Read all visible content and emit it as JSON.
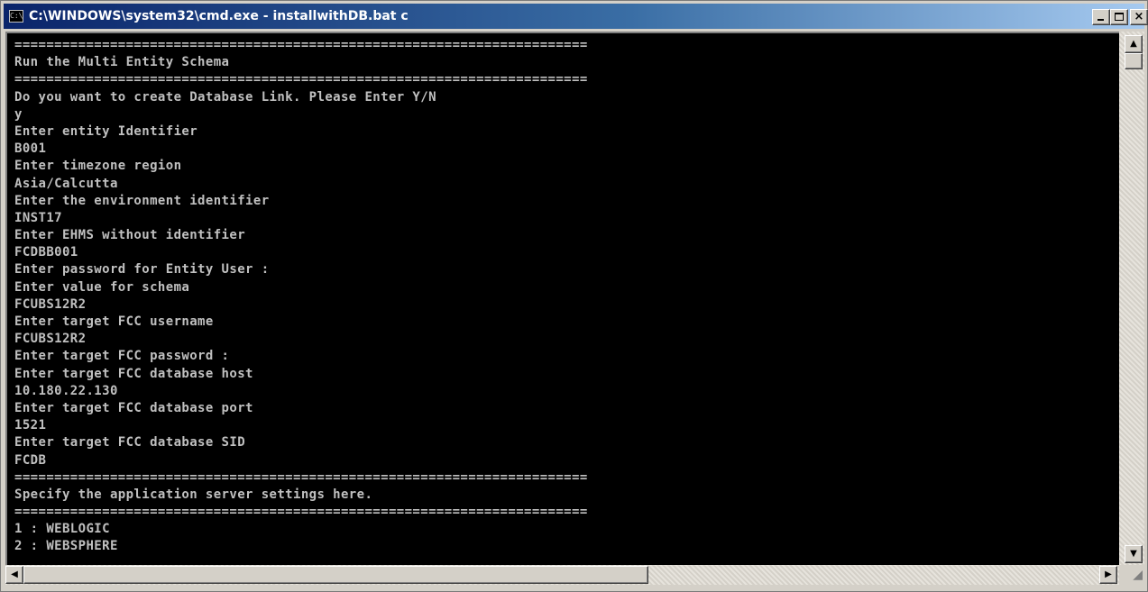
{
  "window": {
    "title": "C:\\WINDOWS\\system32\\cmd.exe - installwithDB.bat c",
    "icon_name": "cmd-console-icon",
    "icon_text": "C:\\",
    "minimize_label": "_",
    "maximize_label": "□",
    "close_label": "×"
  },
  "colors": {
    "title_bar_start": "#0a246a",
    "title_bar_end": "#a6caf0",
    "console_background": "#000000",
    "console_text": "#c0c0c0",
    "chrome": "#d4d0c8"
  },
  "console": {
    "lines": [
      "========================================================================",
      "Run the Multi Entity Schema",
      "========================================================================",
      "Do you want to create Database Link. Please Enter Y/N",
      "y",
      "Enter entity Identifier",
      "B001",
      "Enter timezone region",
      "Asia/Calcutta",
      "Enter the environment identifier",
      "INST17",
      "Enter EHMS without identifier",
      "FCDBB001",
      "Enter password for Entity User :",
      "Enter value for schema",
      "FCUBS12R2",
      "Enter target FCC username",
      "FCUBS12R2",
      "Enter target FCC password :",
      "Enter target FCC database host",
      "10.180.22.130",
      "Enter target FCC database port",
      "1521",
      "Enter target FCC database SID",
      "FCDB",
      "========================================================================",
      "Specify the application server settings here.",
      "========================================================================",
      "1 : WEBLOGIC",
      "2 : WEBSPHERE"
    ]
  },
  "scrollbars": {
    "up_arrow": "▲",
    "down_arrow": "▼",
    "left_arrow": "◀",
    "right_arrow": "▶",
    "resize_grip": "◢"
  }
}
